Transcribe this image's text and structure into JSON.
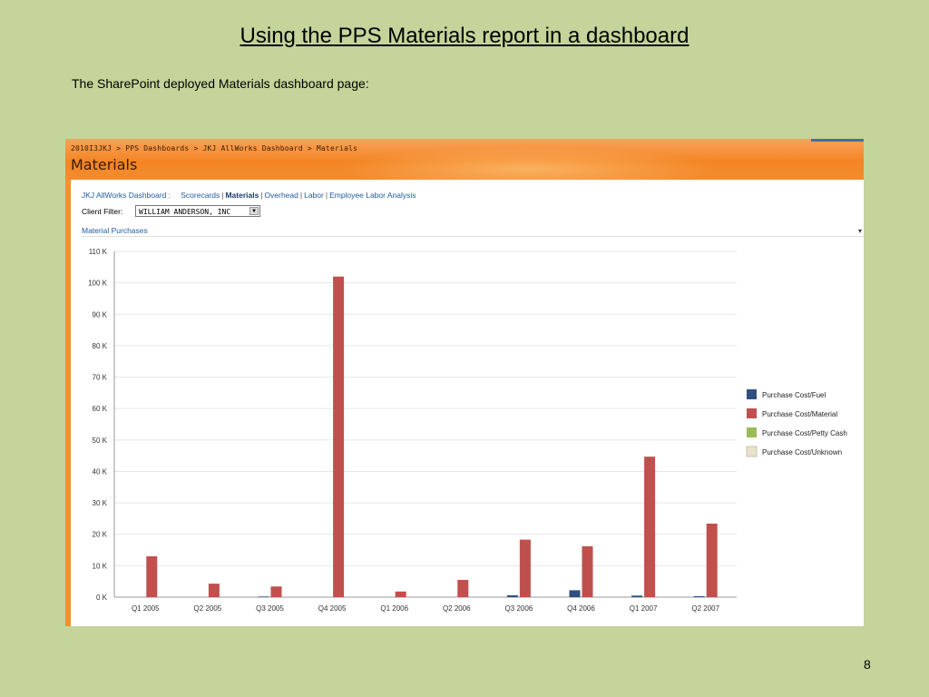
{
  "slide": {
    "title": "Using the PPS Materials report in a dashboard",
    "subtitle": "The SharePoint deployed Materials dashboard page:",
    "page_number": "8"
  },
  "sharepoint": {
    "breadcrumb": "2010I3JKJ > PPS Dashboards > JKJ AllWorks Dashboard > Materials",
    "page_title": "Materials",
    "nav": {
      "label": "JKJ AllWorks Dashboard :",
      "items": [
        "Scorecards",
        "Materials",
        "Overhead",
        "Labor",
        "Employee Labor Analysis"
      ],
      "current": "Materials"
    },
    "filter": {
      "label": "Client Filter:",
      "value": "WILLIAM ANDERSON, INC"
    },
    "webpart_title": "Material Purchases"
  },
  "colors": {
    "fuel": "#2f4f7f",
    "material": "#c0504d",
    "petty_cash": "#9bbb59",
    "unknown": "#e8e2cc"
  },
  "chart_data": {
    "type": "bar",
    "categories": [
      "Q1 2005",
      "Q2 2005",
      "Q3 2005",
      "Q4 2005",
      "Q1 2006",
      "Q2 2006",
      "Q3 2006",
      "Q4 2006",
      "Q1 2007",
      "Q2 2007"
    ],
    "series": [
      {
        "name": "Purchase Cost/Fuel",
        "values": [
          0,
          0,
          200,
          0,
          0,
          0,
          600,
          2200,
          500,
          300
        ]
      },
      {
        "name": "Purchase Cost/Material",
        "values": [
          13000,
          4300,
          3400,
          102000,
          1800,
          5500,
          18300,
          16200,
          44700,
          23400
        ]
      },
      {
        "name": "Purchase Cost/Petty Cash",
        "values": [
          0,
          0,
          0,
          0,
          0,
          0,
          0,
          0,
          0,
          0
        ]
      },
      {
        "name": "Purchase Cost/Unknown",
        "values": [
          0,
          0,
          0,
          0,
          0,
          0,
          0,
          0,
          0,
          0
        ]
      }
    ],
    "ylim": [
      0,
      110000
    ],
    "yticks": [
      "0 K",
      "10 K",
      "20 K",
      "30 K",
      "40 K",
      "50 K",
      "60 K",
      "70 K",
      "80 K",
      "90 K",
      "100 K",
      "110 K"
    ],
    "grid": true,
    "legend_position": "right"
  }
}
